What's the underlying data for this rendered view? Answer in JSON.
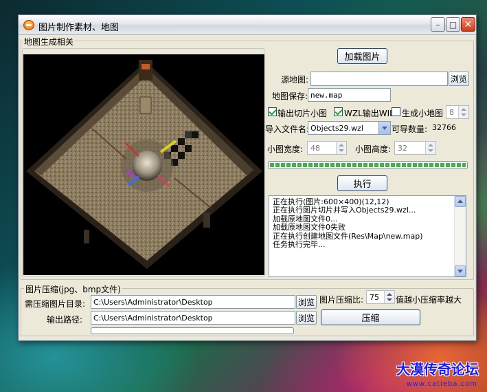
{
  "window": {
    "title": "图片制作素材、地图",
    "minimize_label": "–",
    "maximize_label": "□",
    "close_label": "✕"
  },
  "map_group": {
    "legend": "地图生成相关",
    "load_image_button": "加载图片",
    "source_map_label": "源地图:",
    "source_map_value": "",
    "browse_label": "浏览",
    "map_save_label": "地图保存:",
    "map_save_value": "new.map",
    "output_slices_label": "输出切片小图",
    "output_slices_checked": true,
    "wzl_output_label": "WZL输出WIL",
    "wzl_output_checked": true,
    "gen_minimap_label": "生成小地图",
    "gen_minimap_checked": false,
    "minimap_value": "8",
    "import_filename_label": "导入文件名:",
    "import_filename_value": "Objects29.wzl",
    "importable_count_label": "可导数量:",
    "importable_count_value": "32766",
    "tile_width_label": "小图宽度:",
    "tile_width_value": "48",
    "tile_height_label": "小图高度:",
    "tile_height_value": "32",
    "execute_button": "执行",
    "progress_fraction": 1.0,
    "log_lines": [
      "正在执行(图片:600×400)(12,12)",
      "正在执行图片切片并写入Objects29.wzl...",
      "加载原地图文件0...",
      "加载原地图文件0失败",
      "正在执行创建地图文件(Res\\Map\\new.map)",
      "任务执行完毕..."
    ]
  },
  "compress_group": {
    "legend": "图片压缩(jpg、bmp文件)",
    "source_dir_label": "需压缩图片目录:",
    "source_dir_value": "C:\\Users\\Administrator\\Desktop",
    "output_path_label": "输出路径:",
    "output_path_value": "C:\\Users\\Administrator\\Desktop",
    "browse_label": "浏览",
    "ratio_label": "图片压缩比:",
    "ratio_value": "75",
    "ratio_hint": "值越小压缩率越大",
    "compress_button": "压缩",
    "progress_fraction": 0.0
  },
  "watermark": {
    "text": "大漠传奇论坛",
    "url": "www.catieba.com"
  }
}
